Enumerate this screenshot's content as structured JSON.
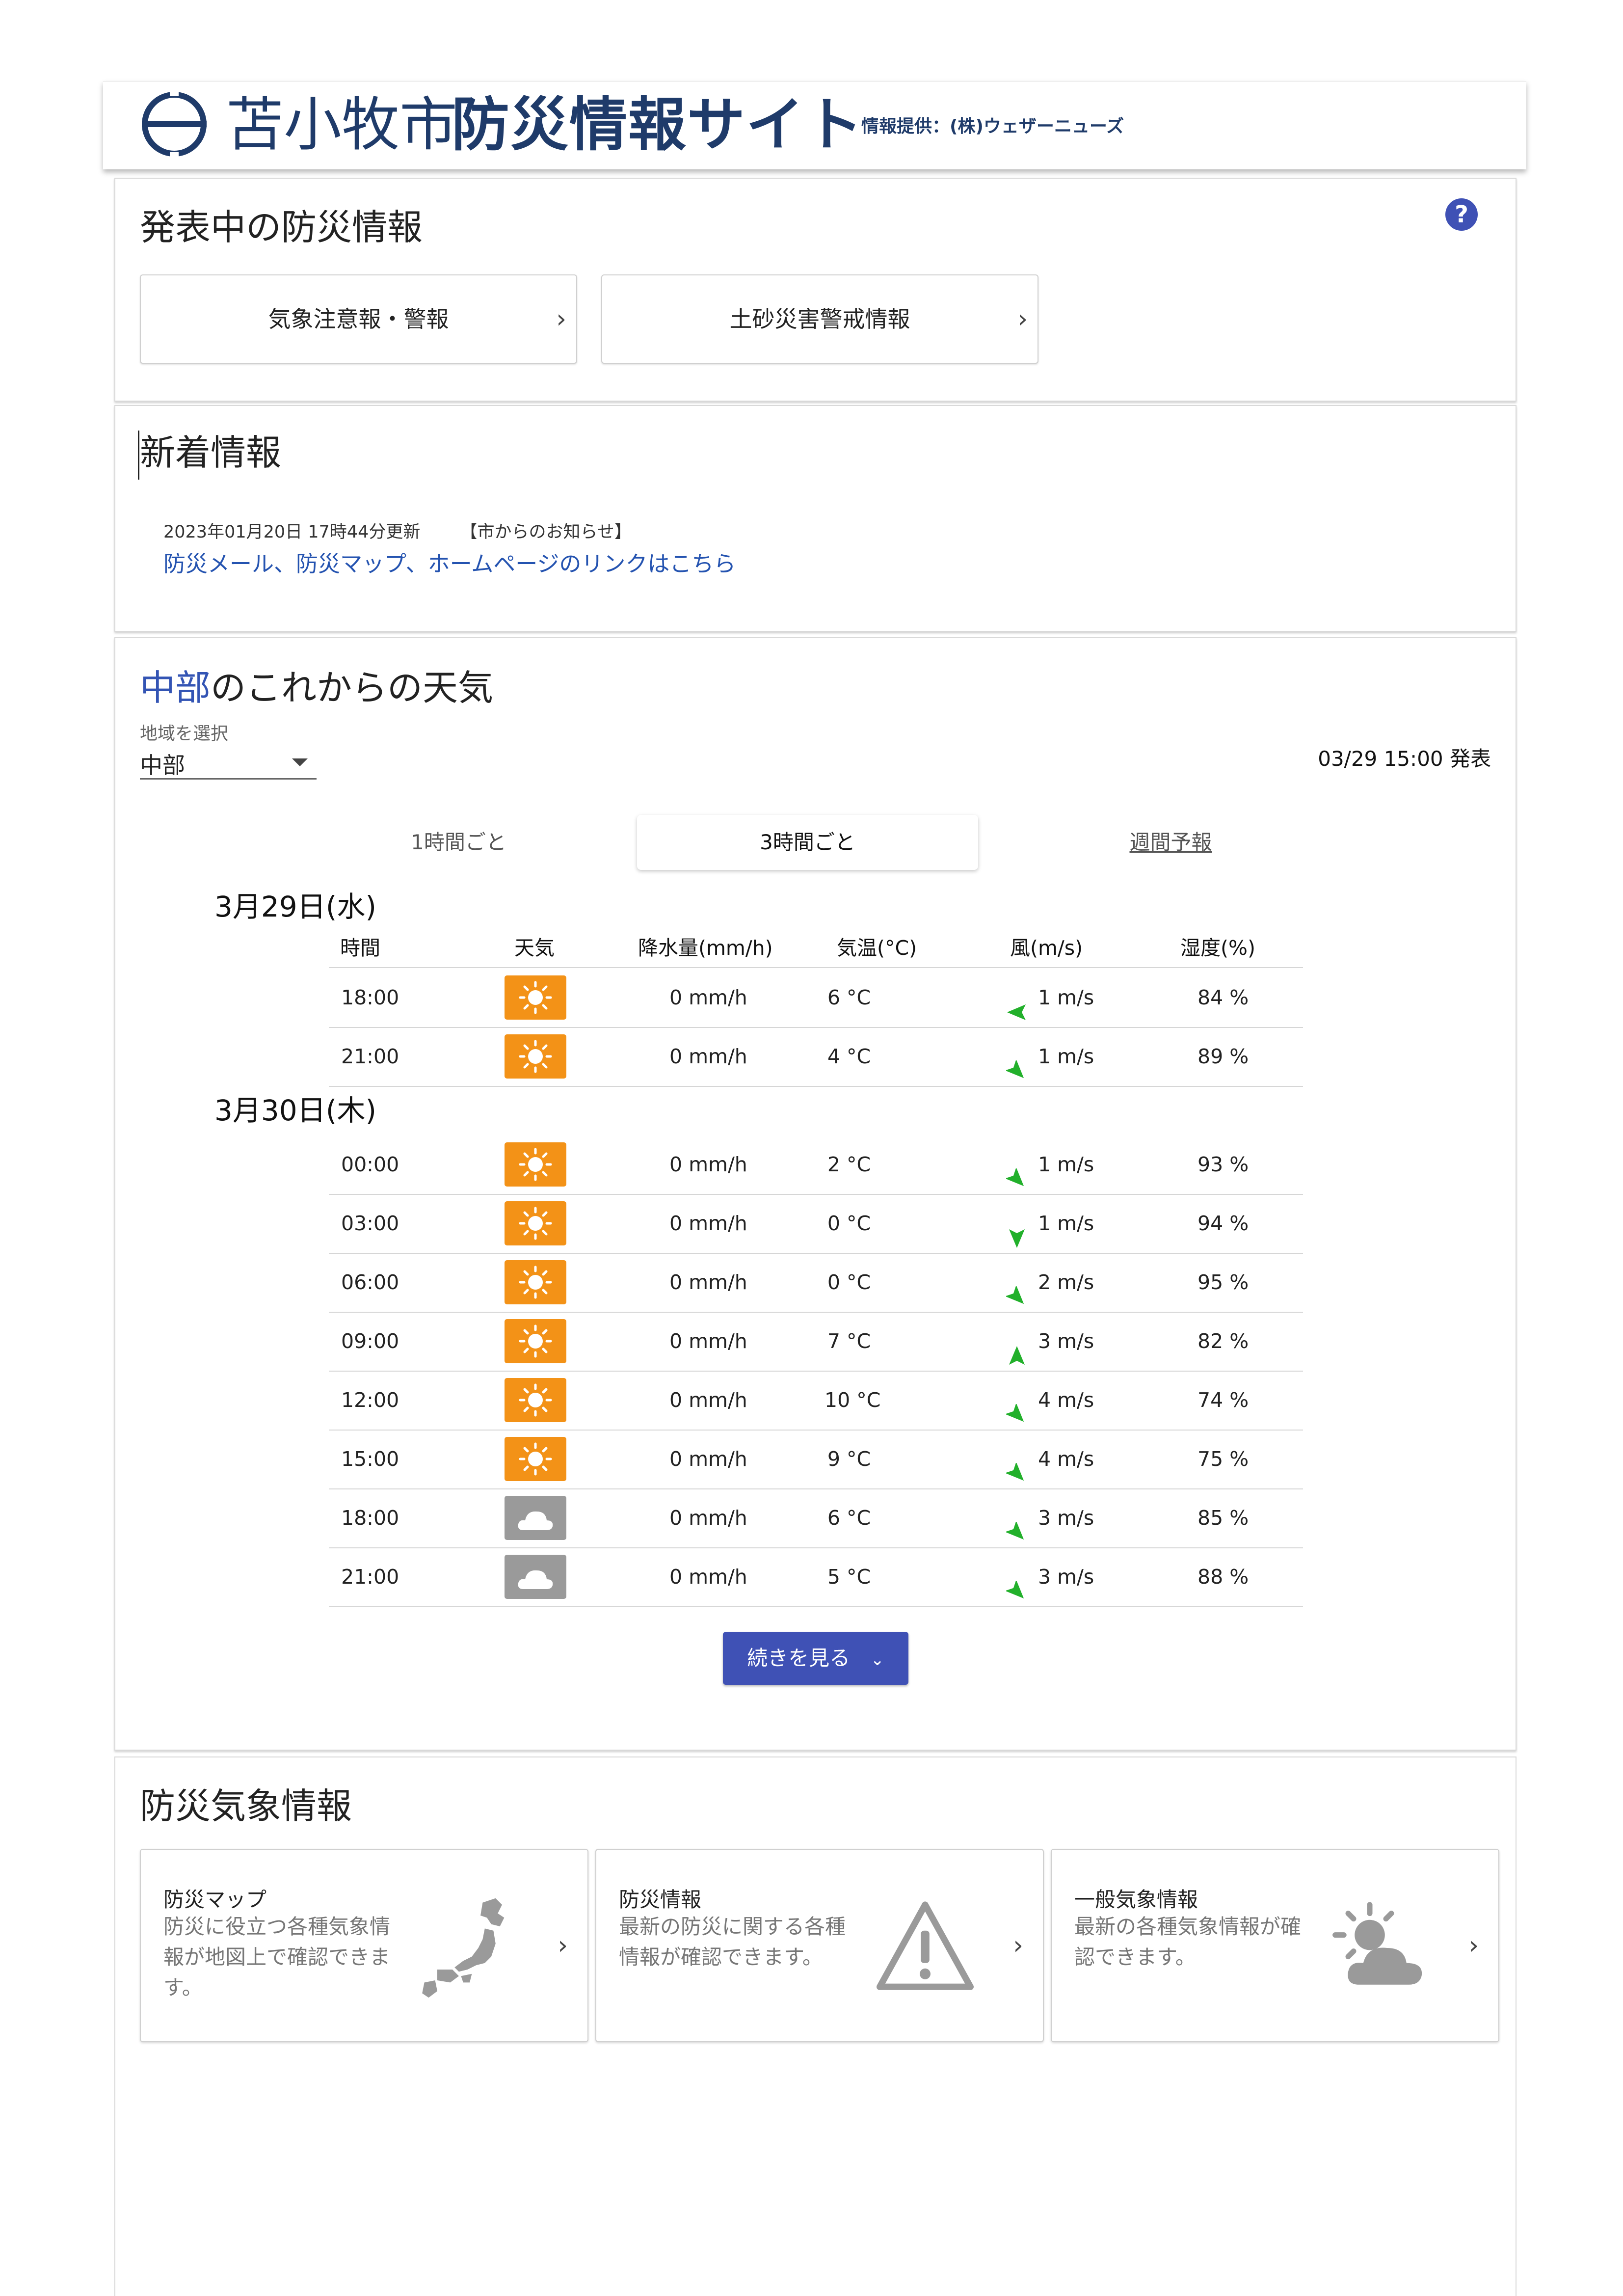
{
  "header": {
    "title_light": "苫小牧市",
    "title_bold": "防災情報サイト",
    "provider": "情報提供：(株)ウェザーニューズ"
  },
  "alerts": {
    "title": "発表中の防災情報",
    "help_icon": "?",
    "buttons": [
      {
        "label": "気象注意報・警報"
      },
      {
        "label": "土砂災害警戒情報"
      }
    ]
  },
  "news": {
    "title": "新着情報",
    "date": "2023年01月20日 17時44分更新",
    "category": "【市からのお知らせ】",
    "link": "防災メール、防災マップ、ホームページのリンクはこちら"
  },
  "weather": {
    "title_accent": "中部",
    "title_rest": "のこれからの天気",
    "area_label": "地域を選択",
    "area_value": "中部",
    "issued": "03/29 15:00 発表",
    "tabs": [
      "1時間ごと",
      "3時間ごと",
      "週間予報"
    ],
    "columns": [
      "時間",
      "天気",
      "降水量(mm/h)",
      "気温(°C)",
      "風(m/s)",
      "湿度(%)"
    ],
    "days": [
      {
        "date": "3月29日(水)",
        "rows": [
          {
            "time": "18:00",
            "icon": "sun-icon",
            "rain": "0 mm/h",
            "temp": "6 °C",
            "wind_dir": "west",
            "wind": "1 m/s",
            "humidity": "84 %"
          },
          {
            "time": "21:00",
            "icon": "sun-icon",
            "rain": "0 mm/h",
            "temp": "4 °C",
            "wind_dir": "south-east",
            "wind": "1 m/s",
            "humidity": "89 %"
          }
        ]
      },
      {
        "date": "3月30日(木)",
        "rows": [
          {
            "time": "00:00",
            "icon": "sun-icon",
            "rain": "0 mm/h",
            "temp": "2 °C",
            "wind_dir": "south-east",
            "wind": "1 m/s",
            "humidity": "93 %"
          },
          {
            "time": "03:00",
            "icon": "sun-icon",
            "rain": "0 mm/h",
            "temp": "0 °C",
            "wind_dir": "south",
            "wind": "1 m/s",
            "humidity": "94 %"
          },
          {
            "time": "06:00",
            "icon": "sun-icon",
            "rain": "0 mm/h",
            "temp": "0 °C",
            "wind_dir": "south-east",
            "wind": "2 m/s",
            "humidity": "95 %"
          },
          {
            "time": "09:00",
            "icon": "sun-icon",
            "rain": "0 mm/h",
            "temp": "7 °C",
            "wind_dir": "north",
            "wind": "3 m/s",
            "humidity": "82 %"
          },
          {
            "time": "12:00",
            "icon": "sun-icon",
            "rain": "0 mm/h",
            "temp": "10 °C",
            "wind_dir": "south-east",
            "wind": "4 m/s",
            "humidity": "74 %"
          },
          {
            "time": "15:00",
            "icon": "sun-icon",
            "rain": "0 mm/h",
            "temp": "9 °C",
            "wind_dir": "south-east",
            "wind": "4 m/s",
            "humidity": "75 %"
          },
          {
            "time": "18:00",
            "icon": "cloud-icon",
            "rain": "0 mm/h",
            "temp": "6 °C",
            "wind_dir": "south-east",
            "wind": "3 m/s",
            "humidity": "85 %"
          },
          {
            "time": "21:00",
            "icon": "cloud-icon",
            "rain": "0 mm/h",
            "temp": "5 °C",
            "wind_dir": "south-east",
            "wind": "3 m/s",
            "humidity": "88 %"
          }
        ]
      }
    ],
    "more_label": "続きを見る",
    "colors": {
      "sun": "#f39217",
      "cloud": "#9a9a9a",
      "wind_arrow": "#22b02b",
      "accent": "#3354b4",
      "button": "#3f51b5"
    }
  },
  "disaster": {
    "title": "防災気象情報",
    "cards": [
      {
        "title": "防災マップ",
        "desc": "防災に役立つ各種気象情報が地図上で確認できます。",
        "icon": "japan-map-icon"
      },
      {
        "title": "防災情報",
        "desc": "最新の防災に関する各種情報が確認できます。",
        "icon": "warning-icon"
      },
      {
        "title": "一般気象情報",
        "desc": "最新の各種気象情報が確認できます。",
        "icon": "partly-cloudy-icon"
      }
    ]
  }
}
